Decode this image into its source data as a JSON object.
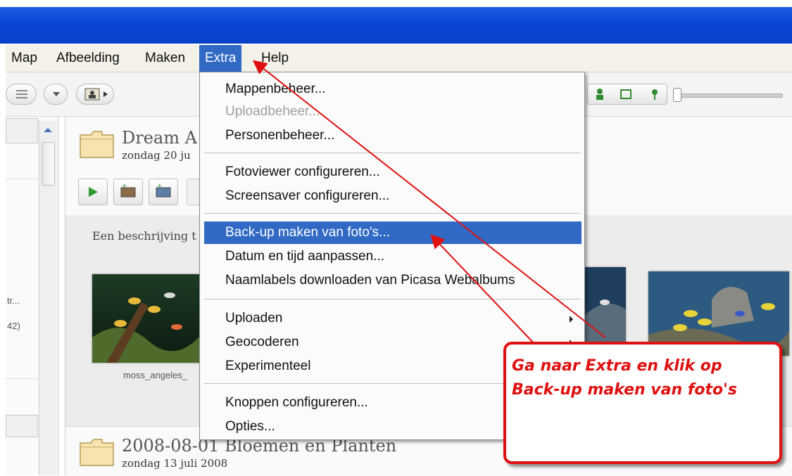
{
  "menubar": {
    "items": [
      "Map",
      "Afbeelding",
      "Maken",
      "Extra",
      "Help"
    ]
  },
  "dropdown": {
    "items": [
      {
        "label": "Mappenbeheer..."
      },
      {
        "label": "Uploadbeheer..."
      },
      {
        "label": "Personenbeheer..."
      },
      {
        "label": "Fotoviewer configureren..."
      },
      {
        "label": "Screensaver configureren..."
      },
      {
        "label": "Back-up maken van foto's..."
      },
      {
        "label": "Datum en tijd aanpassen..."
      },
      {
        "label": "Naamlabels downloaden van Picasa Webalbums"
      },
      {
        "label": "Uploaden"
      },
      {
        "label": "Geocoderen"
      },
      {
        "label": "Experimenteel"
      },
      {
        "label": "Knoppen configureren..."
      },
      {
        "label": "Opties..."
      }
    ]
  },
  "left_panel": {
    "truncated_text": "tr...",
    "count_text": "42)"
  },
  "albums": [
    {
      "title": "Dream A",
      "date": "zondag 20 ju",
      "description": "Een beschrijving t",
      "thumb_caption": "moss_angeles_"
    },
    {
      "title": "2008-08-01 Bloemen en Planten",
      "date": "zondag 13 juli 2008"
    }
  ],
  "callout": {
    "line1": "Ga naar Extra en klik op",
    "line2": "Back-up maken van foto's"
  },
  "colors": {
    "highlight": "#316ac5",
    "callout_red": "#e01010",
    "titlebar_blue": "#0a47d6"
  }
}
